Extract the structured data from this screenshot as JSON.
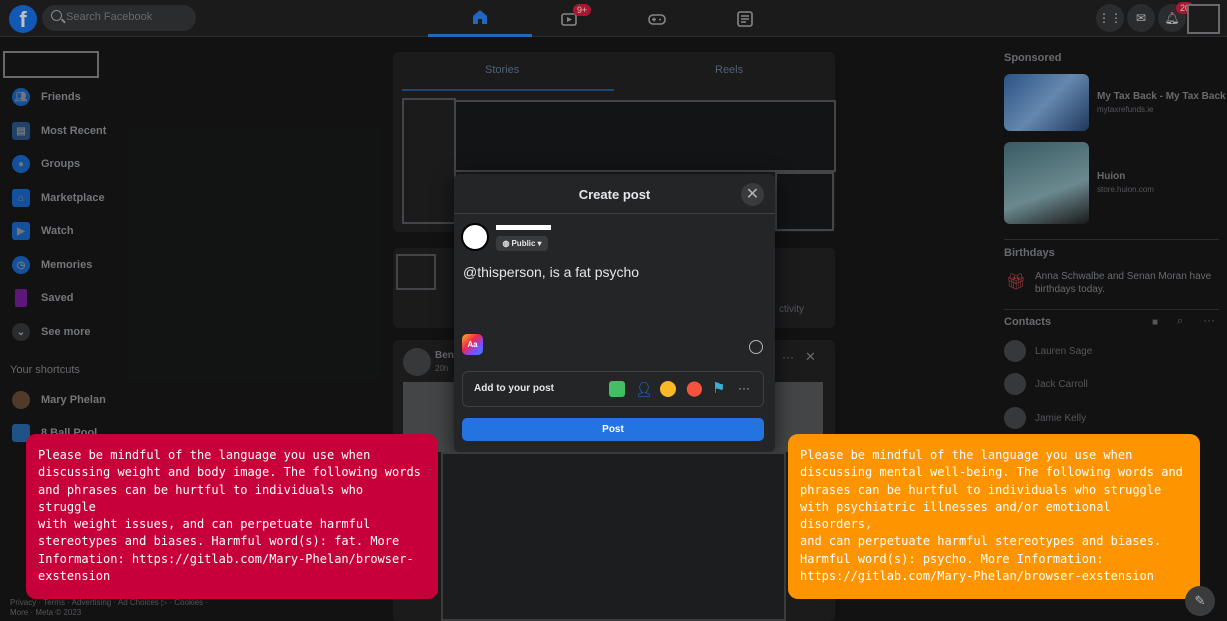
{
  "topnav": {
    "search_placeholder": "Search Facebook",
    "watch_badge": "9+",
    "notif_badge": "20"
  },
  "sidebar": {
    "items": [
      {
        "label": "Friends",
        "icon": "friends-icon"
      },
      {
        "label": "Most Recent",
        "icon": "most-recent-icon"
      },
      {
        "label": "Groups",
        "icon": "groups-icon"
      },
      {
        "label": "Marketplace",
        "icon": "marketplace-icon"
      },
      {
        "label": "Watch",
        "icon": "watch-icon"
      },
      {
        "label": "Memories",
        "icon": "memories-icon"
      },
      {
        "label": "Saved",
        "icon": "saved-icon"
      },
      {
        "label": "See more",
        "icon": "chevron-down-icon"
      }
    ],
    "shortcuts_label": "Your shortcuts",
    "shortcuts": [
      {
        "label": "Mary Phelan"
      },
      {
        "label": "8 Ball Pool"
      }
    ],
    "footer": "Privacy · Terms · Advertising · Ad Choices ▷ · Cookies · More · Meta © 2023"
  },
  "feed": {
    "stories_tab": "Stories",
    "reels_tab": "Reels",
    "post_author_short": "Ben",
    "post_time_short": "20h",
    "activity_short": "ctivity"
  },
  "right": {
    "sponsored_label": "Sponsored",
    "ads": [
      {
        "title": "My Tax Back - My Tax Back",
        "url": "mytaxrefunds.ie"
      },
      {
        "title": "Huion",
        "url": "store.huion.com"
      }
    ],
    "birthdays_label": "Birthdays",
    "birthday_text": "Anna Schwalbe and Senan Moran have birthdays today.",
    "contacts_label": "Contacts",
    "contacts": [
      "Lauren Sage",
      "Jack Carroll",
      "Jamie Kelly"
    ]
  },
  "modal": {
    "title": "Create post",
    "privacy_label": "Public",
    "post_text": "@thisperson, is a fat psycho",
    "aa_label": "Aa",
    "add_to_post_label": "Add to your post",
    "post_button": "Post"
  },
  "warnings": {
    "weight": "Please be mindful of the language you use when\ndiscussing weight and body image. The following words\nand phrases can be hurtful to individuals who struggle\nwith weight issues, and can perpetuate harmful\nstereotypes and biases. Harmful word(s): fat. More\nInformation: https://gitlab.com/Mary-Phelan/browser-\nexstension",
    "mental": "Please be mindful of the language you use when\ndiscussing mental well-being. The following words and\nphrases can be hurtful to individuals who struggle\nwith psychiatric illnesses and/or emotional disorders,\nand can perpetuate harmful stereotypes and biases.\nHarmful word(s): psycho. More Information:\nhttps://gitlab.com/Mary-Phelan/browser-exstension"
  },
  "colors": {
    "weight_warning": "#c8003a",
    "mental_warning": "#fd9400",
    "accent": "#2374e1"
  }
}
